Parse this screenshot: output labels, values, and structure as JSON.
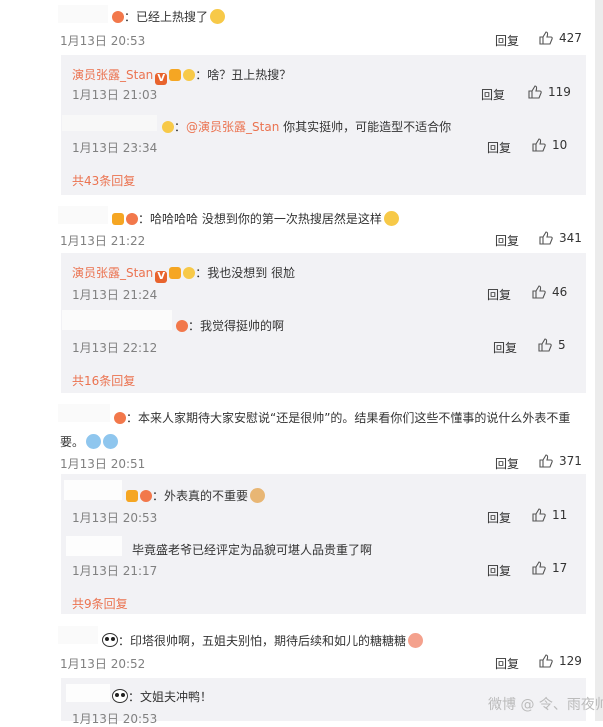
{
  "comments": [
    {
      "text": "：已经上热搜了",
      "time": "1月13日 20:53",
      "reply_label": "回复",
      "likes": "427",
      "replies": [
        {
          "user": "演员张露_Stan",
          "text": "：啥？丑上热搜？",
          "time": "1月13日 21:03",
          "reply_label": "回复",
          "likes": "119"
        },
        {
          "user": "",
          "mention": "@演员张露_Stan",
          "text": " 你其实挺帅，可能造型不适合你",
          "time": "1月13日 23:34",
          "reply_label": "回复",
          "likes": "10"
        }
      ],
      "more_label": "共43条回复"
    },
    {
      "text": "：哈哈哈哈  没想到你的第一次热搜居然是这样",
      "time": "1月13日 21:22",
      "reply_label": "回复",
      "likes": "341",
      "replies": [
        {
          "user": "演员张露_Stan",
          "text": "：我也没想到 很尬",
          "time": "1月13日 21:24",
          "reply_label": "回复",
          "likes": "46"
        },
        {
          "user": "",
          "text": "：我觉得挺帅的啊",
          "time": "1月13日 22:12",
          "reply_label": "回复",
          "likes": "5"
        }
      ],
      "more_label": "共16条回复"
    },
    {
      "text_line1": "：本来人家期待大家安慰说“还是很帅”的。结果看你们这些不懂事的说什么外表不重",
      "text_line2": "要。",
      "time": "1月13日 20:51",
      "reply_label": "回复",
      "likes": "371",
      "replies": [
        {
          "user": "",
          "text": "：外表真的不重要",
          "time": "1月13日 20:53",
          "reply_label": "回复",
          "likes": "11"
        },
        {
          "user": "",
          "text": "毕竟盛老爷已经评定为品貌可堪人品贵重了啊",
          "time": "1月13日 21:17",
          "reply_label": "回复",
          "likes": "17"
        }
      ],
      "more_label": "共9条回复"
    },
    {
      "text": "：印塔很帅啊，五姐夫别怕，期待后续和如儿的糖糖糖",
      "time": "1月13日 20:52",
      "reply_label": "回复",
      "likes": "129",
      "replies": [
        {
          "user": "",
          "text": "：文姐夫冲鸭！",
          "time": "1月13日 20:53",
          "reply_label": "回复",
          "likes": ""
        }
      ]
    }
  ],
  "watermark": "微博 @ 令、雨夜帅",
  "colors": {
    "name": "#eb7350",
    "time": "#808080",
    "reply_bg": "#f2f2f5"
  },
  "icons": {
    "like": "thumbs-up-icon",
    "v_badge": "verified-v-icon",
    "crown": "crown-icon",
    "gold": "gold-medal-icon",
    "fire": "fire-icon"
  }
}
